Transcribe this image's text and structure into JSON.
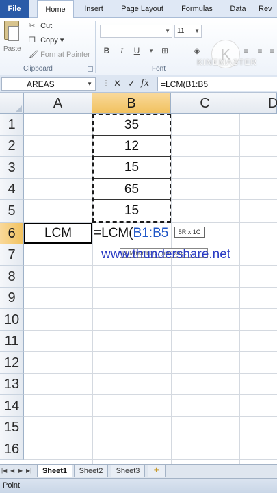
{
  "ribbon": {
    "tabs": {
      "file": "File",
      "home": "Home",
      "insert": "Insert",
      "page_layout": "Page Layout",
      "formulas": "Formulas",
      "data": "Data",
      "review": "Rev"
    },
    "clipboard": {
      "paste": "Paste",
      "cut": "Cut",
      "copy": "Copy",
      "copy_dropdown": "▾",
      "format_painter": "Format Painter",
      "group_label": "Clipboard"
    },
    "font": {
      "size": "11",
      "group_label": "Font",
      "bold": "B",
      "italic": "I",
      "underline": "U"
    },
    "overlay_logo": "KINEMASTER",
    "overlay_logo_glyph": "K"
  },
  "formula_bar": {
    "name_box": "AREAS",
    "cancel": "✕",
    "enter": "✓",
    "fx": "fx",
    "content": "=LCM(B1:B5"
  },
  "grid": {
    "columns": [
      "A",
      "B",
      "C",
      "D"
    ],
    "rows": [
      "1",
      "2",
      "3",
      "4",
      "5",
      "6",
      "7",
      "8",
      "9",
      "10",
      "11",
      "12",
      "13",
      "14",
      "15",
      "16"
    ],
    "b_values": [
      "35",
      "12",
      "15",
      "65",
      "15"
    ],
    "a6": "LCM",
    "b6_formula_prefix": "=LCM(",
    "b6_formula_ref": "B1:B5",
    "size_tooltip": "5R x 1C",
    "arg_tooltip": "LCM(number1, [number2], ...)",
    "watermark": "www.thundershare.net"
  },
  "sheets": {
    "tabs": [
      "Sheet1",
      "Sheet2",
      "Sheet3"
    ],
    "active": "Sheet1"
  },
  "status": {
    "mode": "Point"
  }
}
